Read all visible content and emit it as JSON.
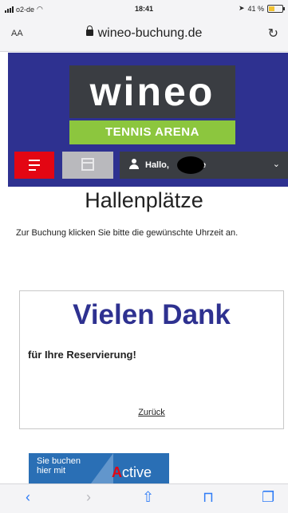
{
  "status_bar": {
    "carrier": "o2-de",
    "time": "18:41",
    "battery": "41 %",
    "battery_level": 0.41
  },
  "browser": {
    "text_size_label": "AA",
    "url": "wineo-buchung.de"
  },
  "site": {
    "logo_text": "wineo",
    "logo_subtitle": "TENNIS ARENA",
    "user_greeting": "Hallo,",
    "user_greeting_suffix": "e"
  },
  "page": {
    "title": "Hallenplätze",
    "instruction": "Zur Buchung klicken Sie bitte die gewünschte Uhrzeit an."
  },
  "confirmation": {
    "heading": "Vielen Dank",
    "subheading": "für Ihre Reservierung!",
    "back_link": "Zurück"
  },
  "banner": {
    "text": "Sie buchen hier mit",
    "brand_first_letter": "A",
    "brand_rest": "ctive"
  },
  "icons": {
    "menu": "menu-icon",
    "calendar": "calendar-icon",
    "user": "user-icon",
    "chevron": "chevron-down-icon",
    "back": "back-arrow-icon",
    "forward": "forward-arrow-icon",
    "share": "share-icon",
    "bookmarks": "bookmarks-icon",
    "tabs": "tabs-icon"
  },
  "colors": {
    "brand_blue": "#2e3190",
    "brand_green": "#8cc63e",
    "menu_red": "#e30613",
    "ios_blue": "#2f7cf6"
  }
}
